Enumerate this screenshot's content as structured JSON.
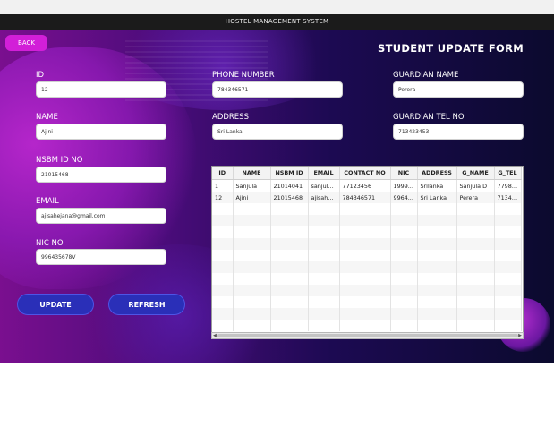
{
  "window": {
    "title": "HOSTEL MANAGEMENT SYSTEM"
  },
  "header": {
    "back_label": "BACK",
    "form_title": "STUDENT UPDATE FORM"
  },
  "form": {
    "id": {
      "label": "ID",
      "value": "12"
    },
    "name": {
      "label": "NAME",
      "value": "Ajini"
    },
    "nsbm_id": {
      "label": "NSBM ID NO",
      "value": "21015468"
    },
    "email": {
      "label": "EMAIL",
      "value": "ajisahejana@gmail.com"
    },
    "nic": {
      "label": "NIC NO",
      "value": "996435678V"
    },
    "phone": {
      "label": "PHONE NUMBER",
      "value": "784346571"
    },
    "address": {
      "label": "ADDRESS",
      "value": "Sri Lanka"
    },
    "guardian_name": {
      "label": "GUARDIAN NAME",
      "value": "Perera"
    },
    "guardian_tel": {
      "label": "GUARDIAN TEL NO",
      "value": "713423453"
    }
  },
  "buttons": {
    "update": "UPDATE",
    "refresh": "REFRESH"
  },
  "table": {
    "headers": [
      "ID",
      "NAME",
      "NSBM ID",
      "EMAIL",
      "CONTACT NO",
      "NIC",
      "ADDRESS",
      "G_NAME",
      "G_TEL"
    ],
    "rows": [
      [
        "1",
        "Sanjula",
        "21014041",
        "sanjula...",
        "77123456",
        "1999...",
        "Srilanka",
        "Sanjula D",
        "77987..."
      ],
      [
        "12",
        "Ajini",
        "21015468",
        "ajisahej...",
        "784346571",
        "9964...",
        "Sri Lanka",
        "Perera",
        "71342..."
      ]
    ]
  },
  "colors": {
    "back_button": "#d21fd8",
    "action_button": "#2a2fb8"
  }
}
